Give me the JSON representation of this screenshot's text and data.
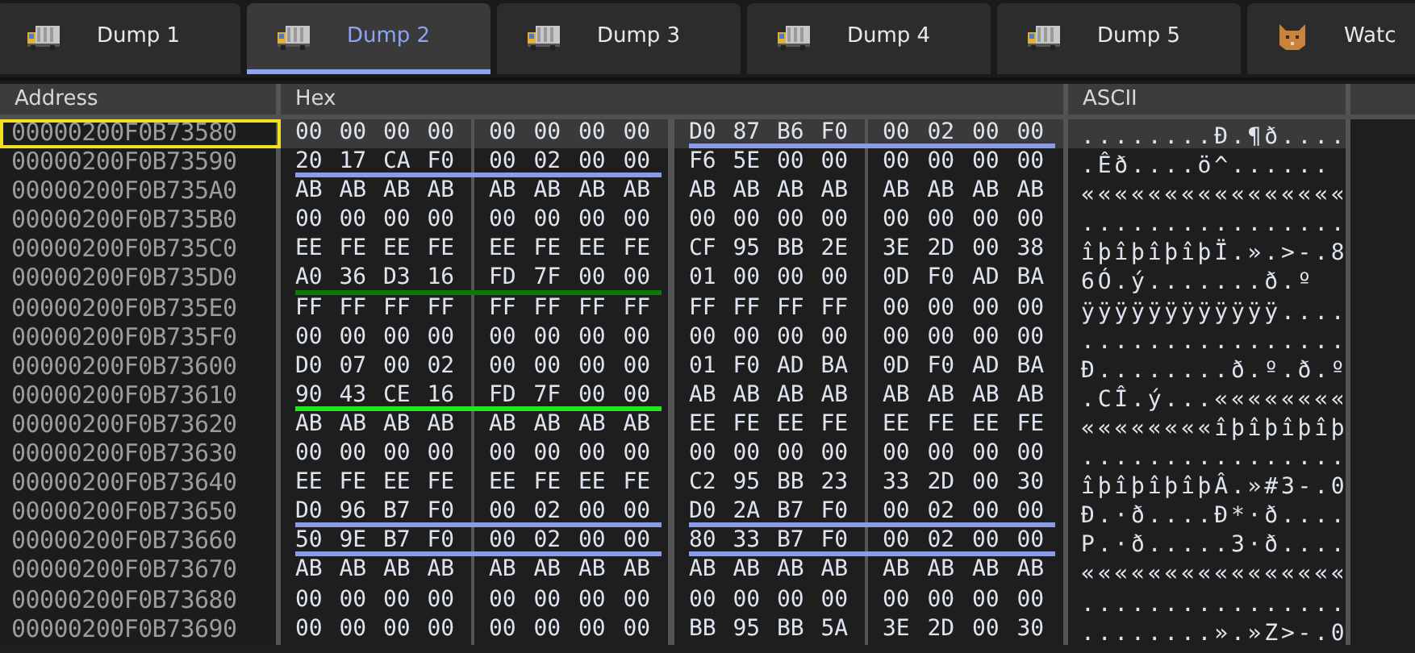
{
  "tabs": [
    {
      "label": "Dump 1",
      "kind": "dump",
      "selected": false
    },
    {
      "label": "Dump 2",
      "kind": "dump",
      "selected": true
    },
    {
      "label": "Dump 3",
      "kind": "dump",
      "selected": false
    },
    {
      "label": "Dump 4",
      "kind": "dump",
      "selected": false
    },
    {
      "label": "Dump 5",
      "kind": "dump",
      "selected": false
    },
    {
      "label": "Watc",
      "kind": "watch",
      "selected": false
    }
  ],
  "columns": [
    "Address",
    "Hex",
    "ASCII"
  ],
  "rows": [
    {
      "address": "00000200F0B73580",
      "outlined": true,
      "selected": true,
      "bytes": [
        "00",
        "00",
        "00",
        "00",
        "00",
        "00",
        "00",
        "00",
        "D0",
        "87",
        "B6",
        "F0",
        "00",
        "02",
        "00",
        "00"
      ],
      "ascii": "........Ð.¶ð....",
      "right_underline": {
        "color": "#8a9be8"
      }
    },
    {
      "address": "00000200F0B73590",
      "outlined": false,
      "selected": false,
      "bytes": [
        "20",
        "17",
        "CA",
        "F0",
        "00",
        "02",
        "00",
        "00",
        "F6",
        "5E",
        "00",
        "00",
        "00",
        "00",
        "00",
        "00"
      ],
      "ascii": " .Êð....ö^......",
      "left_underline": {
        "color": "#8a9be8"
      }
    },
    {
      "address": "00000200F0B735A0",
      "outlined": false,
      "selected": false,
      "bytes": [
        "AB",
        "AB",
        "AB",
        "AB",
        "AB",
        "AB",
        "AB",
        "AB",
        "AB",
        "AB",
        "AB",
        "AB",
        "AB",
        "AB",
        "AB",
        "AB"
      ],
      "ascii": "««««««««««««««««"
    },
    {
      "address": "00000200F0B735B0",
      "outlined": false,
      "selected": false,
      "bytes": [
        "00",
        "00",
        "00",
        "00",
        "00",
        "00",
        "00",
        "00",
        "00",
        "00",
        "00",
        "00",
        "00",
        "00",
        "00",
        "00"
      ],
      "ascii": "................"
    },
    {
      "address": "00000200F0B735C0",
      "outlined": false,
      "selected": false,
      "bytes": [
        "EE",
        "FE",
        "EE",
        "FE",
        "EE",
        "FE",
        "EE",
        "FE",
        "CF",
        "95",
        "BB",
        "2E",
        "3E",
        "2D",
        "00",
        "38"
      ],
      "ascii": "îþîþîþîþÏ.».>-.8"
    },
    {
      "address": "00000200F0B735D0",
      "outlined": false,
      "selected": false,
      "bytes": [
        "A0",
        "36",
        "D3",
        "16",
        "FD",
        "7F",
        "00",
        "00",
        "01",
        "00",
        "00",
        "00",
        "0D",
        "F0",
        "AD",
        "BA"
      ],
      "ascii": " 6Ó.ý.......ð.º",
      "left_underline": {
        "color": "#0a7a0a"
      }
    },
    {
      "address": "00000200F0B735E0",
      "outlined": false,
      "selected": false,
      "bytes": [
        "FF",
        "FF",
        "FF",
        "FF",
        "FF",
        "FF",
        "FF",
        "FF",
        "FF",
        "FF",
        "FF",
        "FF",
        "00",
        "00",
        "00",
        "00"
      ],
      "ascii": "ÿÿÿÿÿÿÿÿÿÿÿÿ...."
    },
    {
      "address": "00000200F0B735F0",
      "outlined": false,
      "selected": false,
      "bytes": [
        "00",
        "00",
        "00",
        "00",
        "00",
        "00",
        "00",
        "00",
        "00",
        "00",
        "00",
        "00",
        "00",
        "00",
        "00",
        "00"
      ],
      "ascii": "................"
    },
    {
      "address": "00000200F0B73600",
      "outlined": false,
      "selected": false,
      "bytes": [
        "D0",
        "07",
        "00",
        "02",
        "00",
        "00",
        "00",
        "00",
        "01",
        "F0",
        "AD",
        "BA",
        "0D",
        "F0",
        "AD",
        "BA"
      ],
      "ascii": "Ð........ð.º.ð.º"
    },
    {
      "address": "00000200F0B73610",
      "outlined": false,
      "selected": false,
      "bytes": [
        "90",
        "43",
        "CE",
        "16",
        "FD",
        "7F",
        "00",
        "00",
        "AB",
        "AB",
        "AB",
        "AB",
        "AB",
        "AB",
        "AB",
        "AB"
      ],
      "ascii": ".CÎ.ý...««««««««",
      "left_underline": {
        "color": "#22e622"
      }
    },
    {
      "address": "00000200F0B73620",
      "outlined": false,
      "selected": false,
      "bytes": [
        "AB",
        "AB",
        "AB",
        "AB",
        "AB",
        "AB",
        "AB",
        "AB",
        "EE",
        "FE",
        "EE",
        "FE",
        "EE",
        "FE",
        "EE",
        "FE"
      ],
      "ascii": "««««««««îþîþîþîþ"
    },
    {
      "address": "00000200F0B73630",
      "outlined": false,
      "selected": false,
      "bytes": [
        "00",
        "00",
        "00",
        "00",
        "00",
        "00",
        "00",
        "00",
        "00",
        "00",
        "00",
        "00",
        "00",
        "00",
        "00",
        "00"
      ],
      "ascii": "................"
    },
    {
      "address": "00000200F0B73640",
      "outlined": false,
      "selected": false,
      "bytes": [
        "EE",
        "FE",
        "EE",
        "FE",
        "EE",
        "FE",
        "EE",
        "FE",
        "C2",
        "95",
        "BB",
        "23",
        "33",
        "2D",
        "00",
        "30"
      ],
      "ascii": "îþîþîþîþÂ.»#3-.0"
    },
    {
      "address": "00000200F0B73650",
      "outlined": false,
      "selected": false,
      "bytes": [
        "D0",
        "96",
        "B7",
        "F0",
        "00",
        "02",
        "00",
        "00",
        "D0",
        "2A",
        "B7",
        "F0",
        "00",
        "02",
        "00",
        "00"
      ],
      "ascii": "Ð.·ð....Ð*·ð....",
      "left_underline": {
        "color": "#8a9be8"
      },
      "right_underline": {
        "color": "#8a9be8"
      }
    },
    {
      "address": "00000200F0B73660",
      "outlined": false,
      "selected": false,
      "bytes": [
        "50",
        "9E",
        "B7",
        "F0",
        "00",
        "02",
        "00",
        "00",
        "80",
        "33",
        "B7",
        "F0",
        "00",
        "02",
        "00",
        "00"
      ],
      "ascii": "P.·ð.....3·ð....",
      "left_underline": {
        "color": "#8a9be8"
      },
      "right_underline": {
        "color": "#8a9be8"
      }
    },
    {
      "address": "00000200F0B73670",
      "outlined": false,
      "selected": false,
      "bytes": [
        "AB",
        "AB",
        "AB",
        "AB",
        "AB",
        "AB",
        "AB",
        "AB",
        "AB",
        "AB",
        "AB",
        "AB",
        "AB",
        "AB",
        "AB",
        "AB"
      ],
      "ascii": "««««««««««««««««"
    },
    {
      "address": "00000200F0B73680",
      "outlined": false,
      "selected": false,
      "bytes": [
        "00",
        "00",
        "00",
        "00",
        "00",
        "00",
        "00",
        "00",
        "00",
        "00",
        "00",
        "00",
        "00",
        "00",
        "00",
        "00"
      ],
      "ascii": "................"
    },
    {
      "address": "00000200F0B73690",
      "outlined": false,
      "selected": false,
      "bytes": [
        "00",
        "00",
        "00",
        "00",
        "00",
        "00",
        "00",
        "00",
        "BB",
        "95",
        "BB",
        "5A",
        "3E",
        "2D",
        "00",
        "30"
      ],
      "ascii": "........».»Z>-.0"
    }
  ]
}
